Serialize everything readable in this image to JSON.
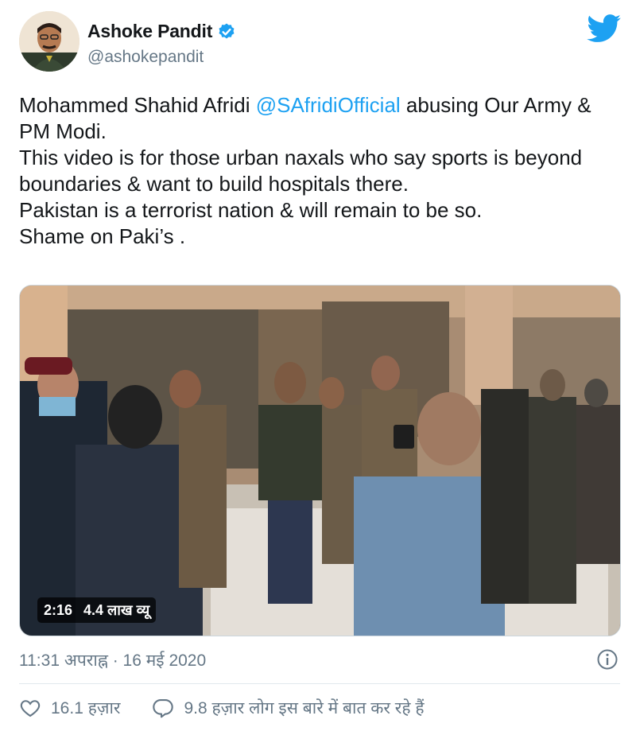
{
  "author": {
    "name": "Ashoke Pandit",
    "handle": "@ashokepandit"
  },
  "tweet": {
    "text_before_mention": "Mohammed Shahid Afridi ",
    "mention": "@SAfridiOfficial",
    "text_after_mention": " abusing  Our Army & PM Modi.\nThis video is for those urban naxals who say sports is beyond boundaries & want to build hospitals there.\nPakistan is a terrorist nation & will remain to be so.\nShame on Paki’s ."
  },
  "video": {
    "duration": "2:16",
    "views": "4.4 लाख व्यू"
  },
  "timestamp": "11:31 अपराह्न · 16 मई 2020",
  "actions": {
    "likes": "16.1 हज़ार",
    "conversation": "9.8 हज़ार लोग इस बारे में बात कर रहे हैं"
  },
  "colors": {
    "accent": "#1da1f2",
    "text": "#14171a",
    "secondary": "#657786"
  },
  "icons": [
    "verified-badge-icon",
    "twitter-bird-icon",
    "info-icon",
    "heart-icon",
    "comment-icon"
  ]
}
